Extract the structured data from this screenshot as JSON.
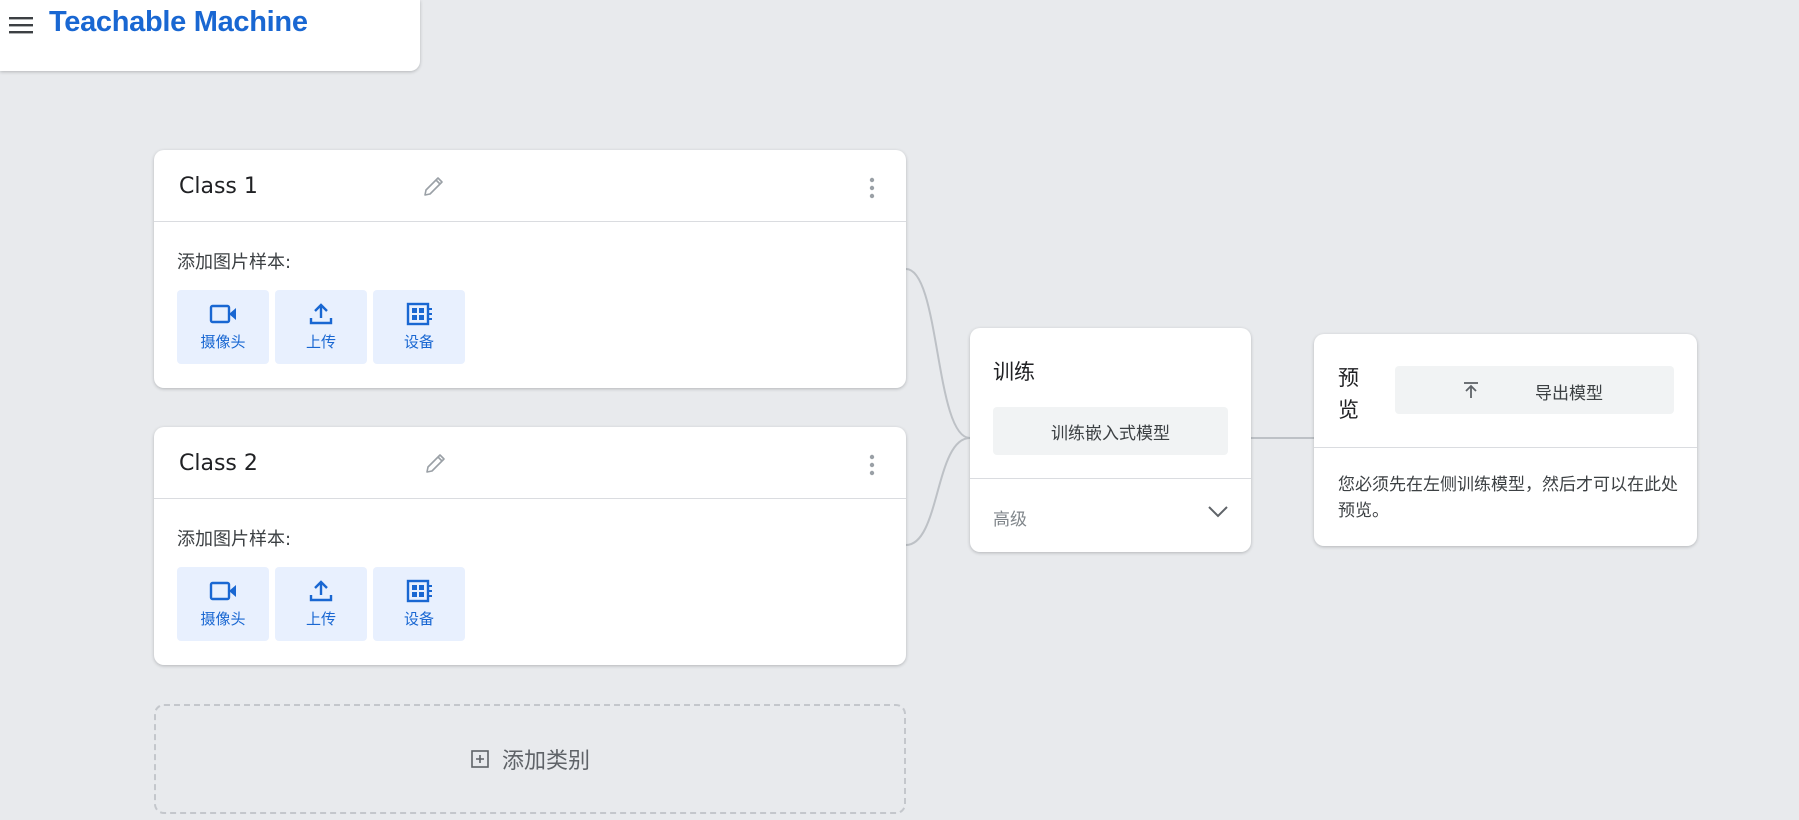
{
  "header": {
    "app_title": "Teachable Machine",
    "menu_icon": "menu-icon"
  },
  "classes": [
    {
      "name": "Class 1",
      "samples_label": "添加图片样本:",
      "buttons": [
        {
          "label": "摄像头",
          "icon": "webcam-icon"
        },
        {
          "label": "上传",
          "icon": "upload-icon"
        },
        {
          "label": "设备",
          "icon": "device-icon"
        }
      ]
    },
    {
      "name": "Class 2",
      "samples_label": "添加图片样本:",
      "buttons": [
        {
          "label": "摄像头",
          "icon": "webcam-icon"
        },
        {
          "label": "上传",
          "icon": "upload-icon"
        },
        {
          "label": "设备",
          "icon": "device-icon"
        }
      ]
    }
  ],
  "add_class": {
    "label": "添加类别",
    "icon": "add-box-icon"
  },
  "training": {
    "title": "训练",
    "train_button": "训练嵌入式模型",
    "advanced_label": "高级"
  },
  "preview": {
    "title": "预览",
    "export_button": "导出模型",
    "message": "您必须先在左侧训练模型，然后才可以在此处预览。"
  },
  "colors": {
    "brand": "#1967d2",
    "background": "#e8eaed",
    "sample_button_bg": "#e8f0fe",
    "neutral_button_bg": "#f1f3f4"
  }
}
